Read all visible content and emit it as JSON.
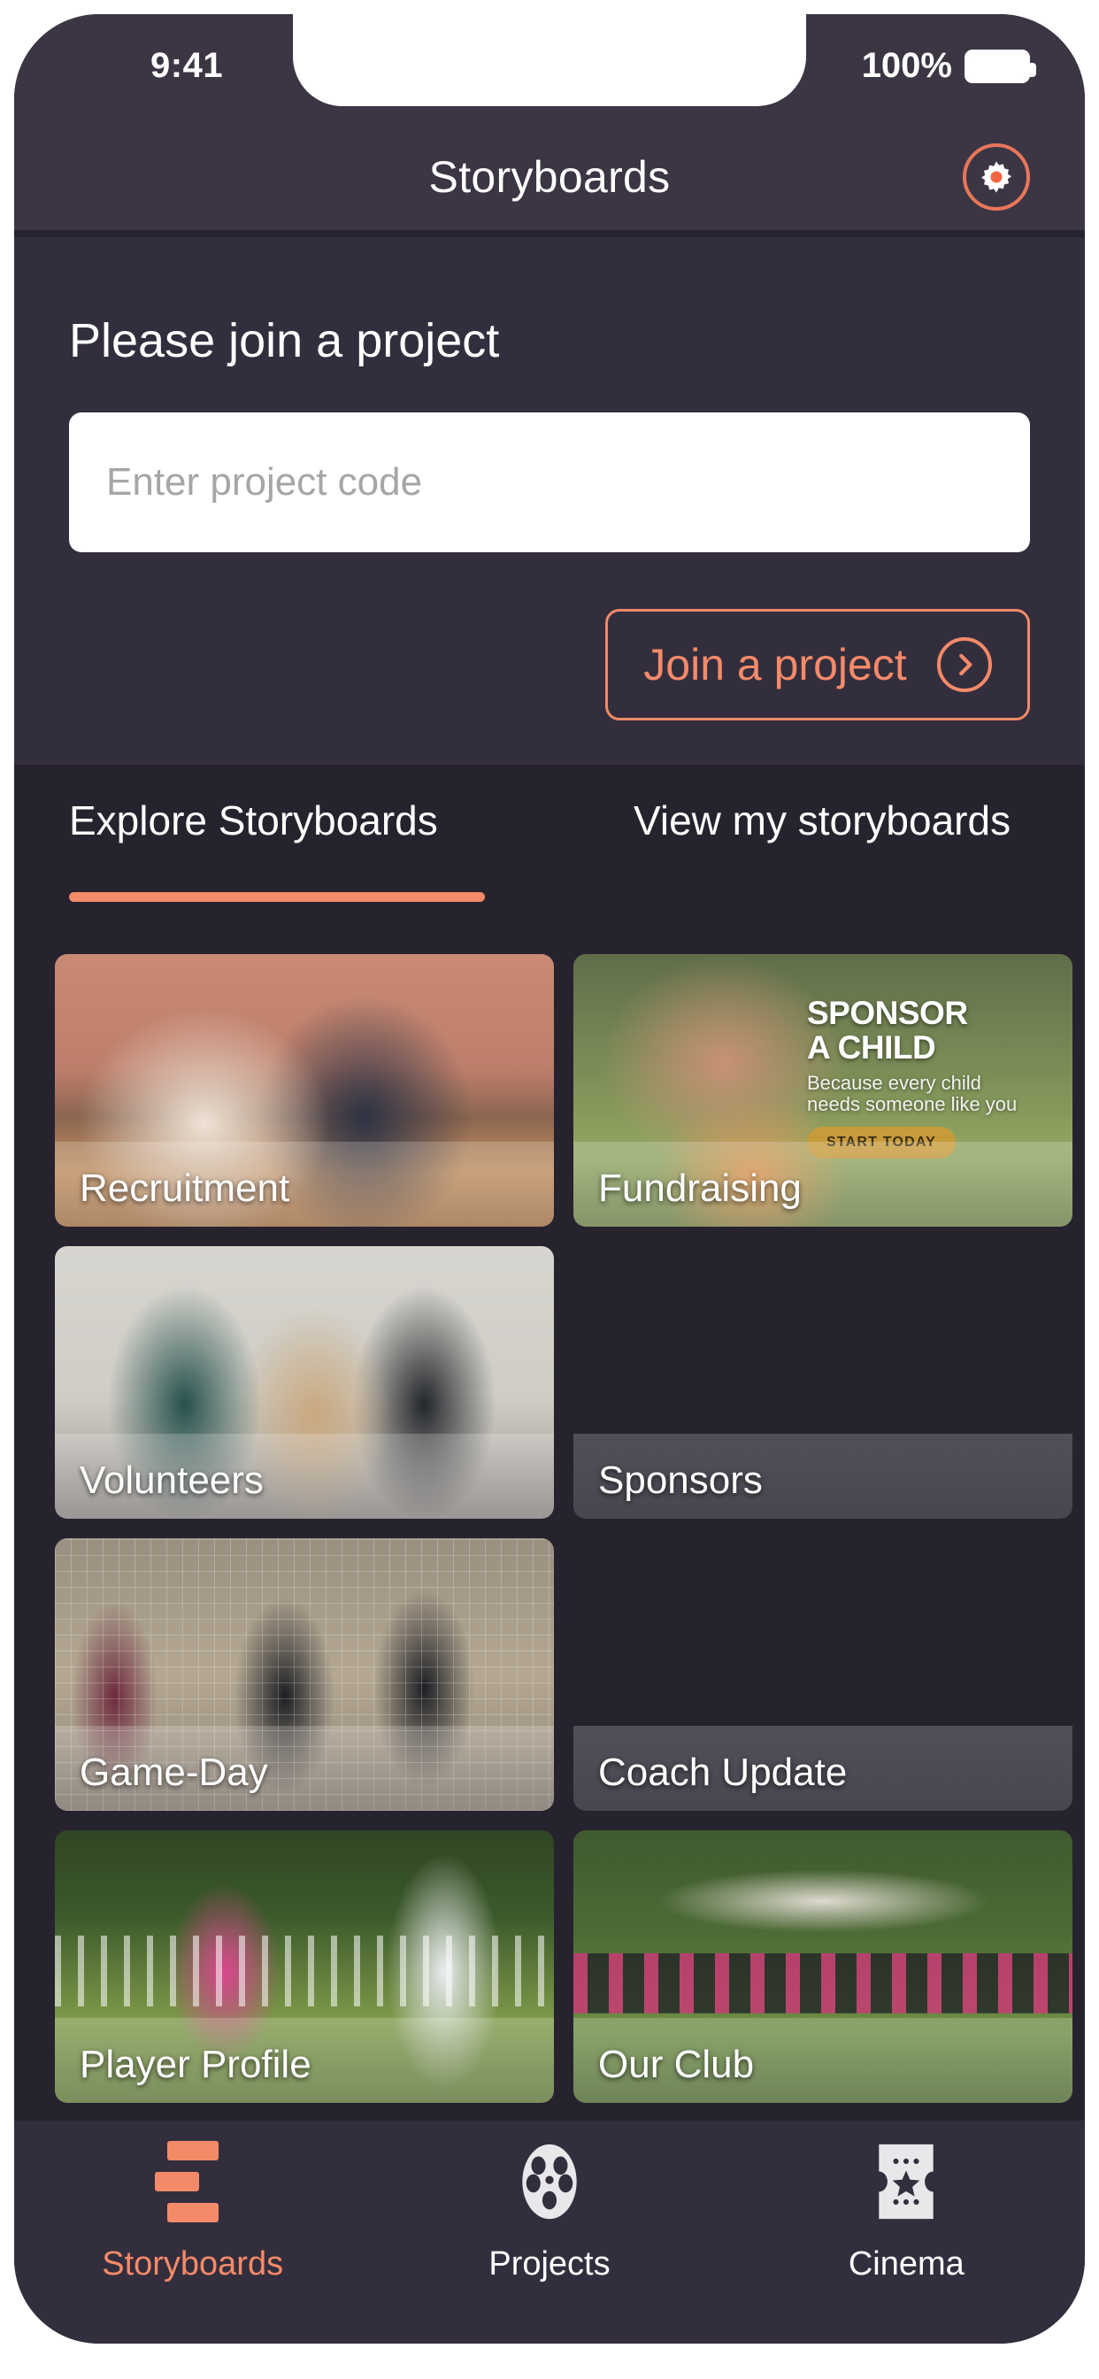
{
  "status_bar": {
    "time": "9:41",
    "battery_percent": "100%",
    "battery_icon": "battery-full-icon"
  },
  "header": {
    "title": "Storyboards",
    "settings_icon": "gear-icon"
  },
  "join_panel": {
    "title": "Please join a project",
    "input_placeholder": "Enter project code",
    "input_value": "",
    "button_label": "Join a project",
    "button_icon": "chevron-right-circle-icon"
  },
  "tabs": [
    {
      "label": "Explore Storyboards",
      "active": true
    },
    {
      "label": "View my storyboards",
      "active": false
    }
  ],
  "cards": [
    {
      "label": "Recruitment"
    },
    {
      "label": "Fundraising",
      "ad": {
        "title_line1": "SPONSOR",
        "title_line2": "A CHILD",
        "sub_line1": "Because every child",
        "sub_line2": "needs someone like you",
        "cta": "START TODAY"
      }
    },
    {
      "label": "Volunteers"
    },
    {
      "label": "Sponsors"
    },
    {
      "label": "Game-Day"
    },
    {
      "label": "Coach Update"
    },
    {
      "label": "Player Profile"
    },
    {
      "label": "Our Club"
    }
  ],
  "bottom_nav": [
    {
      "label": "Storyboards",
      "icon": "storyboards-bars-icon",
      "active": true
    },
    {
      "label": "Projects",
      "icon": "film-reel-icon",
      "active": false
    },
    {
      "label": "Cinema",
      "icon": "movie-ticket-icon",
      "active": false
    }
  ],
  "colors": {
    "accent": "#f58a69",
    "header_bg": "#3b3544",
    "panel_bg": "#332e3d",
    "screen_bg": "#26232e",
    "text": "#ffffff"
  }
}
